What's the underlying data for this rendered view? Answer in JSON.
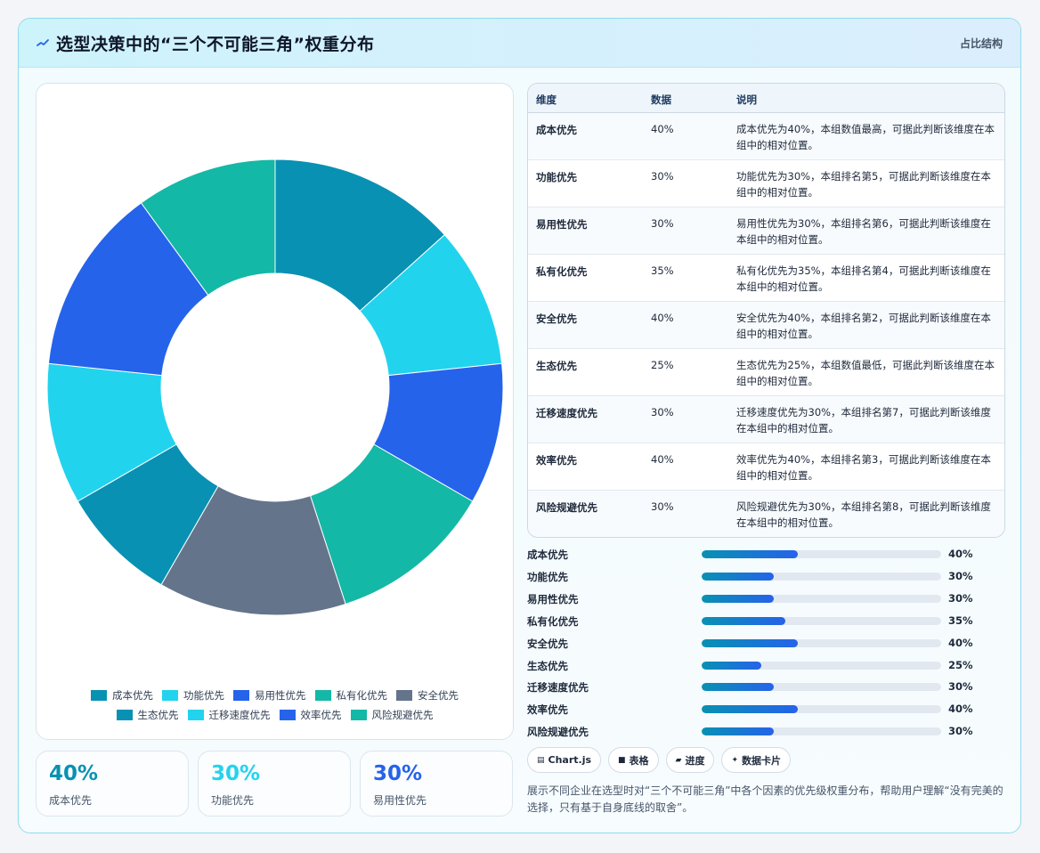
{
  "header": {
    "icon": "zigzag-icon",
    "title": "选型决策中的“三个不可能三角”权重分布",
    "tag": "占比结构"
  },
  "colors": {
    "teal": "#0891b2",
    "cyan": "#22d3ee",
    "blue": "#2563eb",
    "green": "#14b8a6",
    "slate": "#64748b"
  },
  "chart_data": {
    "type": "pie",
    "variant": "doughnut",
    "categories": [
      "成本优先",
      "功能优先",
      "易用性优先",
      "私有化优先",
      "安全优先",
      "生态优先",
      "迁移速度优先",
      "效率优先",
      "风险规避优先"
    ],
    "values": [
      40,
      30,
      30,
      35,
      40,
      25,
      30,
      40,
      30
    ],
    "colors": [
      "#0891b2",
      "#22d3ee",
      "#2563eb",
      "#14b8a6",
      "#64748b",
      "#0891b2",
      "#22d3ee",
      "#2563eb",
      "#14b8a6"
    ],
    "legend_position": "bottom"
  },
  "stats": [
    {
      "value": "40%",
      "label": "成本优先",
      "color": "#0891b2"
    },
    {
      "value": "30%",
      "label": "功能优先",
      "color": "#22d3ee"
    },
    {
      "value": "30%",
      "label": "易用性优先",
      "color": "#2563eb"
    }
  ],
  "table": {
    "headers": [
      "维度",
      "数据",
      "说明"
    ],
    "rows": [
      {
        "dim": "成本优先",
        "value": "40%",
        "note": "成本优先为40%，本组数值最高，可据此判断该维度在本组中的相对位置。"
      },
      {
        "dim": "功能优先",
        "value": "30%",
        "note": "功能优先为30%，本组排名第5，可据此判断该维度在本组中的相对位置。"
      },
      {
        "dim": "易用性优先",
        "value": "30%",
        "note": "易用性优先为30%，本组排名第6，可据此判断该维度在本组中的相对位置。"
      },
      {
        "dim": "私有化优先",
        "value": "35%",
        "note": "私有化优先为35%，本组排名第4，可据此判断该维度在本组中的相对位置。"
      },
      {
        "dim": "安全优先",
        "value": "40%",
        "note": "安全优先为40%，本组排名第2，可据此判断该维度在本组中的相对位置。"
      },
      {
        "dim": "生态优先",
        "value": "25%",
        "note": "生态优先为25%，本组数值最低，可据此判断该维度在本组中的相对位置。"
      },
      {
        "dim": "迁移速度优先",
        "value": "30%",
        "note": "迁移速度优先为30%，本组排名第7，可据此判断该维度在本组中的相对位置。"
      },
      {
        "dim": "效率优先",
        "value": "40%",
        "note": "效率优先为40%，本组排名第3，可据此判断该维度在本组中的相对位置。"
      },
      {
        "dim": "风险规避优先",
        "value": "30%",
        "note": "风险规避优先为30%，本组排名第8，可据此判断该维度在本组中的相对位置。"
      }
    ]
  },
  "bars": [
    {
      "label": "成本优先",
      "value": "40%",
      "fraction": 0.4
    },
    {
      "label": "功能优先",
      "value": "30%",
      "fraction": 0.3
    },
    {
      "label": "易用性优先",
      "value": "30%",
      "fraction": 0.3
    },
    {
      "label": "私有化优先",
      "value": "35%",
      "fraction": 0.35
    },
    {
      "label": "安全优先",
      "value": "40%",
      "fraction": 0.4
    },
    {
      "label": "生态优先",
      "value": "25%",
      "fraction": 0.25
    },
    {
      "label": "迁移速度优先",
      "value": "30%",
      "fraction": 0.3
    },
    {
      "label": "效率优先",
      "value": "40%",
      "fraction": 0.4
    },
    {
      "label": "风险规避优先",
      "value": "30%",
      "fraction": 0.3
    }
  ],
  "chips": [
    {
      "icon": "chart-icon",
      "glyph": "▤",
      "label": "Chart.js"
    },
    {
      "icon": "table-icon",
      "glyph": "■",
      "label": "表格"
    },
    {
      "icon": "progress-icon",
      "glyph": "▰",
      "label": "进度"
    },
    {
      "icon": "sparkle-icon",
      "glyph": "✦",
      "label": "数据卡片"
    }
  ],
  "description": "展示不同企业在选型时对“三个不可能三角”中各个因素的优先级权重分布，帮助用户理解“没有完美的选择，只有基于自身底线的取舍”。"
}
